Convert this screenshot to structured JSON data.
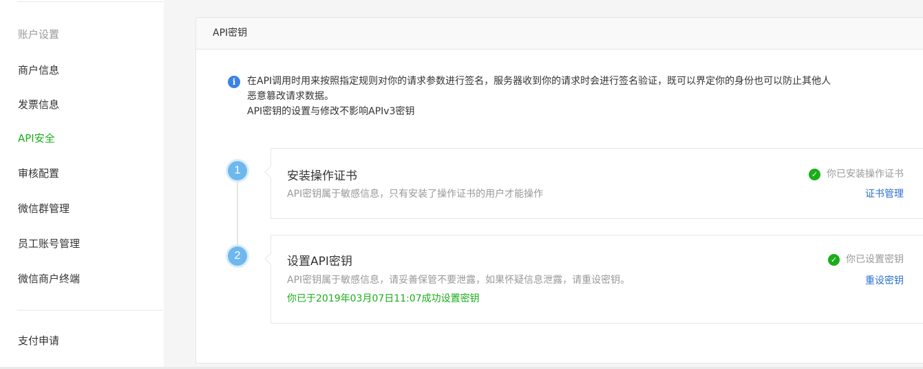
{
  "sidebar": {
    "items": [
      {
        "label": "账户设置",
        "state": "muted"
      },
      {
        "label": "商户信息",
        "state": "normal"
      },
      {
        "label": "发票信息",
        "state": "normal"
      },
      {
        "label": "API安全",
        "state": "active"
      },
      {
        "label": "审核配置",
        "state": "normal"
      },
      {
        "label": "微信群管理",
        "state": "normal"
      },
      {
        "label": "员工账号管理",
        "state": "normal"
      },
      {
        "label": "微信商户终端",
        "state": "normal"
      },
      {
        "label": "支付申请",
        "state": "normal"
      }
    ]
  },
  "panel": {
    "title": "API密钥",
    "notice": {
      "icon": "info-icon",
      "line1": "在API调用时用来按照指定规则对你的请求参数进行签名，服务器收到你的请求时会进行签名验证，既可以界定你的身份也可以防止其他人",
      "line2": "恶意篡改请求数据。",
      "line3": "API密钥的设置与修改不影响APIv3密钥"
    },
    "steps": [
      {
        "number": "1",
        "title": "安装操作证书",
        "description": "API密钥属于敏感信息，只有安装了操作证书的用户才能操作",
        "status": "你已安装操作证书",
        "action": "证书管理"
      },
      {
        "number": "2",
        "title": "设置API密钥",
        "description": "API密钥属于敏感信息，请妥善保管不要泄露，如果怀疑信息泄露，请重设密钥。",
        "success_note": "你已于2019年03月07日11:07成功设置密钥",
        "status": "你已设置密钥",
        "action": "重设密钥"
      }
    ]
  },
  "colors": {
    "accent_green": "#1aad19",
    "link_blue": "#2b6fd0",
    "step_blue": "#6fb8ee",
    "info_blue": "#3b82e6"
  }
}
